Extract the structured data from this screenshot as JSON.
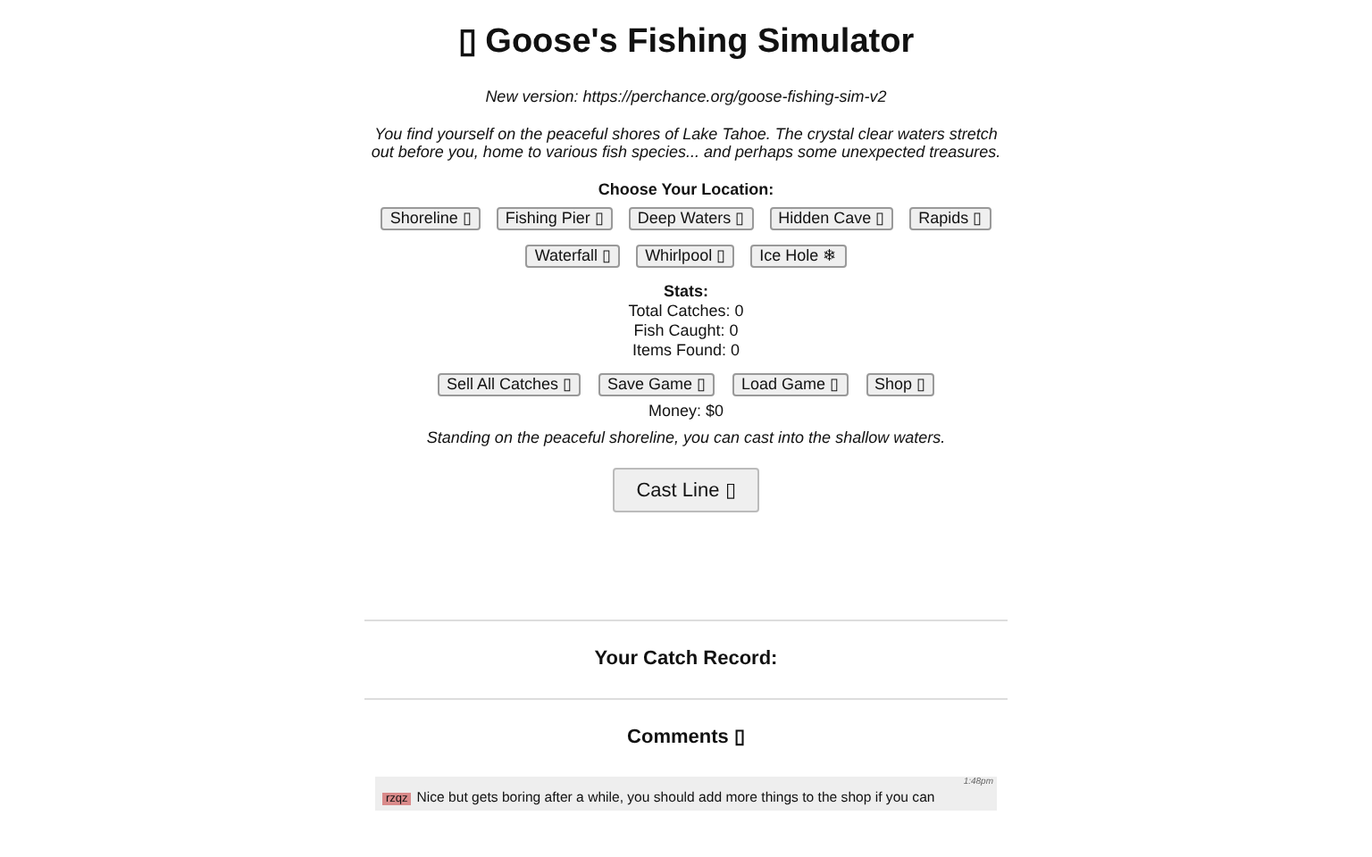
{
  "title": "▯ Goose's Fishing Simulator",
  "version_note": "New version: https://perchance.org/goose-fishing-sim-v2",
  "intro": "You find yourself on the peaceful shores of Lake Tahoe. The crystal clear waters stretch out before you, home to various fish species... and perhaps some unexpected treasures.",
  "location_heading": "Choose Your Location:",
  "locations": [
    {
      "label": "Shoreline ▯"
    },
    {
      "label": "Fishing Pier ▯"
    },
    {
      "label": "Deep Waters ▯"
    },
    {
      "label": "Hidden Cave ▯"
    },
    {
      "label": "Rapids ▯"
    },
    {
      "label": "Waterfall ▯"
    },
    {
      "label": "Whirlpool ▯"
    },
    {
      "label": "Ice Hole ❄"
    }
  ],
  "stats_heading": "Stats:",
  "stats": [
    "Total Catches: 0",
    "Fish Caught: 0",
    "Items Found: 0"
  ],
  "actions": [
    "Sell All Catches ▯",
    "Save Game ▯",
    "Load Game ▯",
    "Shop ▯"
  ],
  "money": "Money: $0",
  "location_description": "Standing on the peaceful shoreline, you can cast into the shallow waters.",
  "cast_button": "Cast Line ▯",
  "catch_record_heading": "Your Catch Record:",
  "comments_heading": "Comments ▯",
  "comments": [
    {
      "user": "rzqz",
      "color": "#d98a8a",
      "time": "1:48pm",
      "text": "Nice but gets boring after a while, you should add more things to the shop if you can"
    }
  ]
}
